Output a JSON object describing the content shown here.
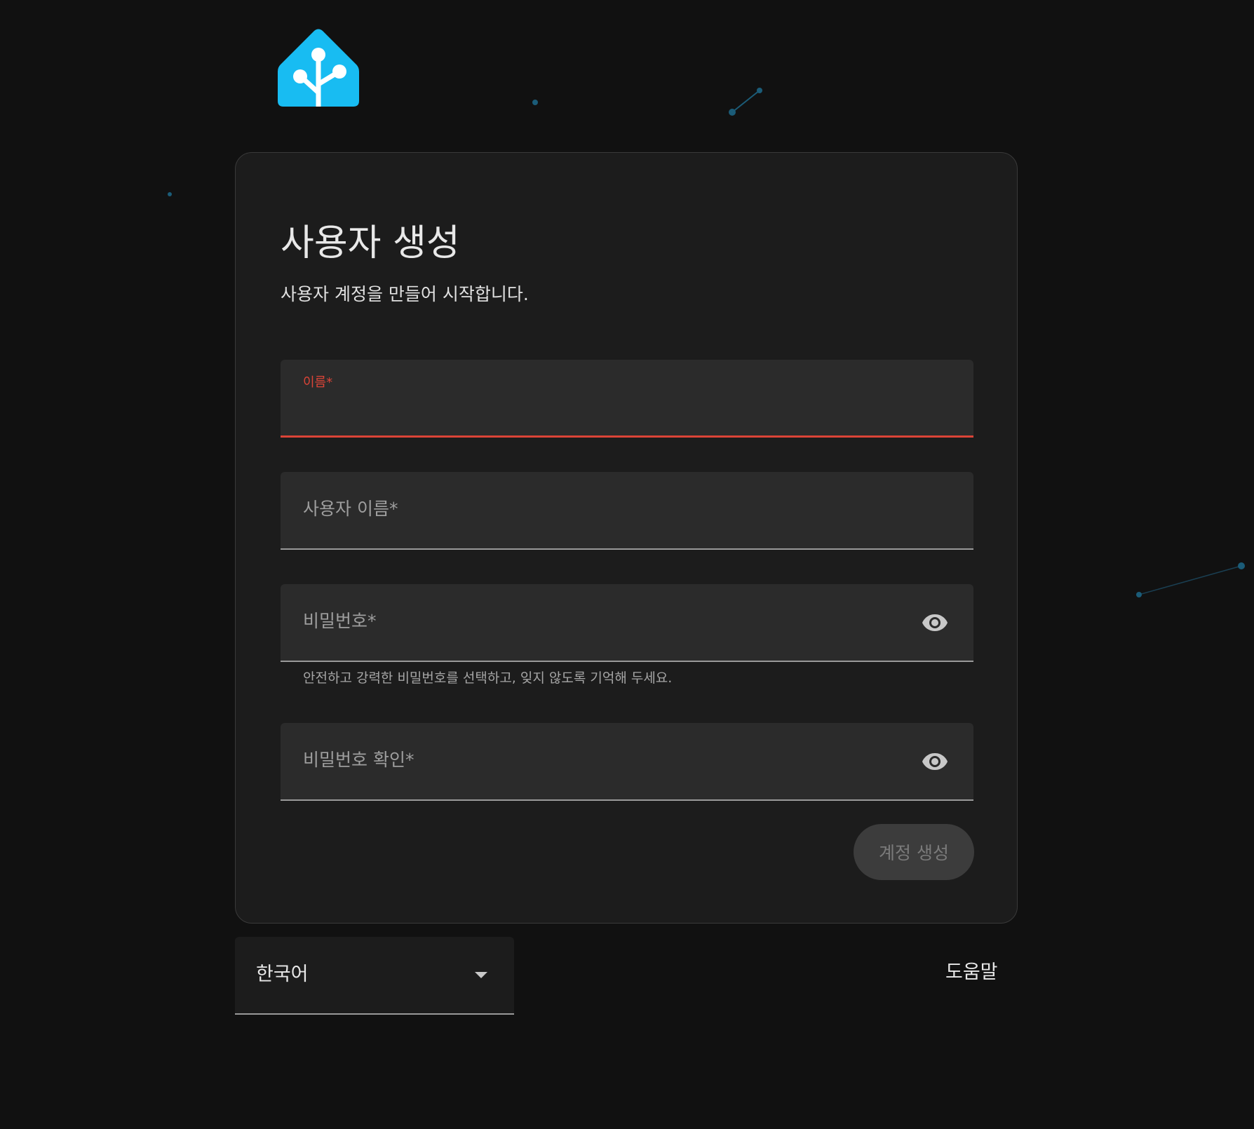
{
  "logo_icon": "home-assistant-logo",
  "brand_color": "#18bcf2",
  "error_color": "#db4437",
  "form": {
    "title": "사용자 생성",
    "subtitle": "사용자 계정을 만들어 시작합니다.",
    "fields": [
      {
        "label": "이름*",
        "value": "",
        "state": "error-focused"
      },
      {
        "label": "사용자 이름*",
        "value": ""
      },
      {
        "label": "비밀번호*",
        "value": "",
        "icon": "eye-icon",
        "helper": "안전하고 강력한 비밀번호를 선택하고, 잊지 않도록 기억해 두세요."
      },
      {
        "label": "비밀번호 확인*",
        "value": "",
        "icon": "eye-icon"
      }
    ],
    "submit_label": "계정 생성",
    "submit_state": "disabled"
  },
  "footer": {
    "language_value": "한국어",
    "language_icon": "chevron-down-icon",
    "help_label": "도움말"
  }
}
